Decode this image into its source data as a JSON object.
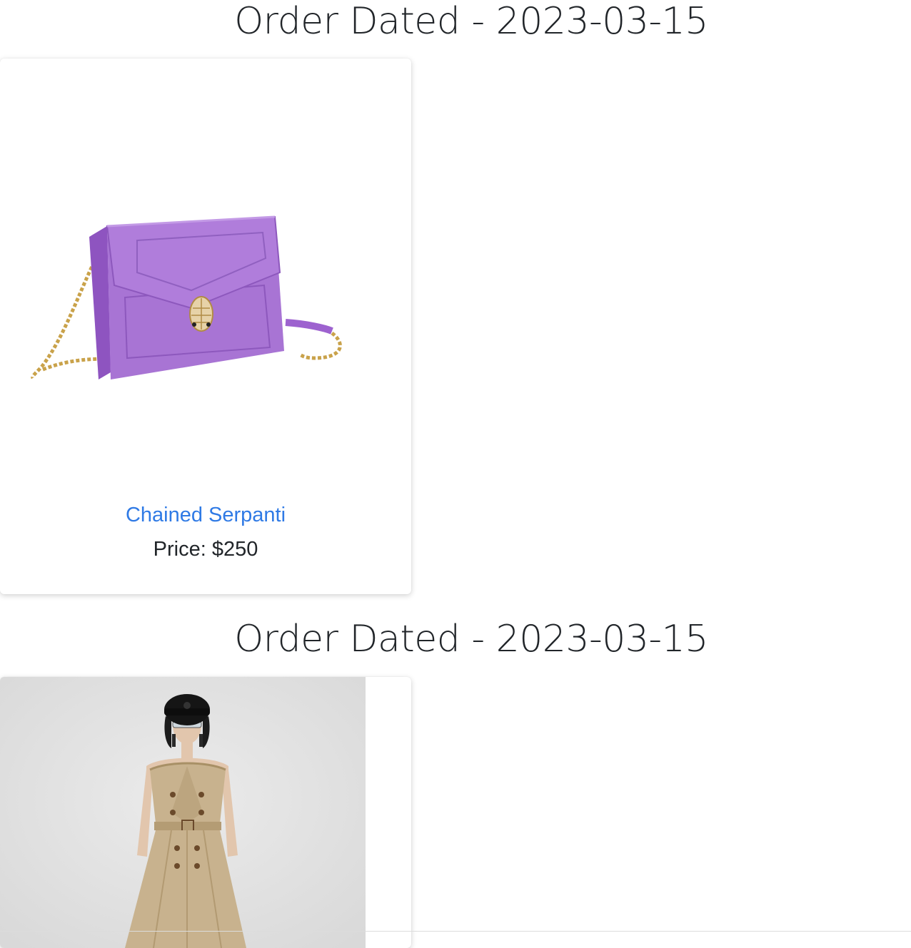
{
  "orders": [
    {
      "title": "Order Dated - 2023-03-15",
      "item": {
        "name": "Chained Serpanti",
        "price": "Price: $250",
        "image": "purple-chain-shoulder-bag-image"
      }
    },
    {
      "title": "Order Dated - 2023-03-15",
      "item": {
        "image": "beige-trench-dress-model-image"
      }
    }
  ],
  "colors": {
    "link": "#2f7ae5",
    "text": "#212529",
    "bag": "#a874d4",
    "chain": "#c9a24a",
    "trench": "#c8b28e",
    "photo_bg": "#e2e2e2"
  }
}
